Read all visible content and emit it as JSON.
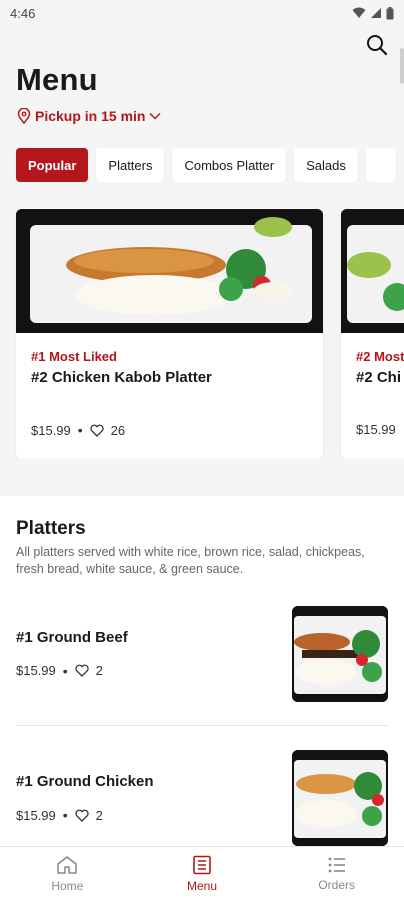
{
  "status": {
    "time": "4:46"
  },
  "header": {
    "title": "Menu",
    "pickup": "Pickup in 15 min"
  },
  "categories": [
    "Popular",
    "Platters",
    "Combos Platter",
    "Salads",
    ""
  ],
  "featured": [
    {
      "rank": "#1 Most Liked",
      "name": "#2 Chicken Kabob Platter",
      "price": "$15.99",
      "likes": "26"
    },
    {
      "rank": "#2 Most",
      "name": "#2 Chi",
      "price": "$15.99",
      "likes": ""
    }
  ],
  "section": {
    "title": "Platters",
    "description": "All platters served with white rice, brown rice, salad, chickpeas, fresh bread, white sauce, & green sauce.",
    "items": [
      {
        "name": "#1 Ground Beef",
        "price": "$15.99",
        "likes": "2"
      },
      {
        "name": "#1 Ground Chicken",
        "price": "$15.99",
        "likes": "2"
      }
    ]
  },
  "tabs": [
    {
      "label": "Home",
      "icon": "home-icon"
    },
    {
      "label": "Menu",
      "icon": "menu-book-icon"
    },
    {
      "label": "Orders",
      "icon": "list-icon"
    }
  ],
  "colors": {
    "accent": "#b3161b",
    "background": "#f5f5f5"
  }
}
